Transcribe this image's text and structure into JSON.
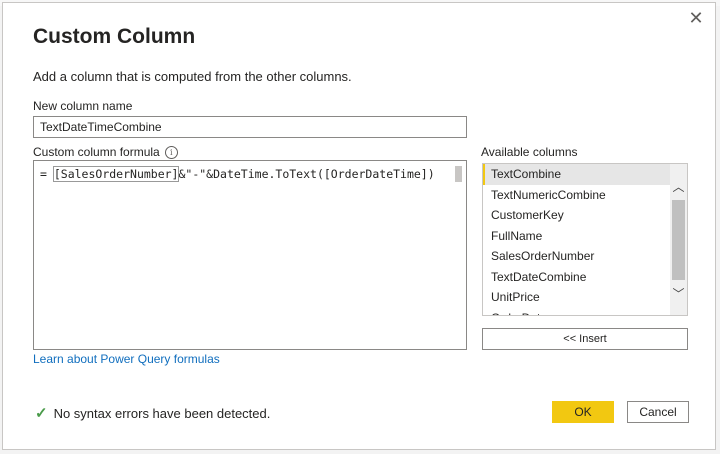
{
  "dialog": {
    "title": "Custom Column",
    "subtitle": "Add a column that is computed from the other columns.",
    "close_icon": "close-icon"
  },
  "new_column": {
    "label": "New column name",
    "value": "TextDateTimeCombine"
  },
  "formula": {
    "label": "Custom column formula",
    "info_icon": "info-icon",
    "prefix": "= ",
    "bracketed": "[SalesOrderNumber]",
    "rest": "&\"-\"&DateTime.ToText([OrderDateTime])"
  },
  "available": {
    "label": "Available columns",
    "items": [
      "TextCombine",
      "TextNumericCombine",
      "CustomerKey",
      "FullName",
      "SalesOrderNumber",
      "TextDateCombine",
      "UnitPrice",
      "OrderDate"
    ],
    "selected_index": 0,
    "insert_label": "<< Insert"
  },
  "learn_link": "Learn about Power Query formulas",
  "status": {
    "icon": "check-icon",
    "text": "No syntax errors have been detected."
  },
  "buttons": {
    "ok": "OK",
    "cancel": "Cancel"
  },
  "colors": {
    "accent": "#f2c811",
    "link": "#106ebe",
    "success": "#4a9b4a"
  }
}
